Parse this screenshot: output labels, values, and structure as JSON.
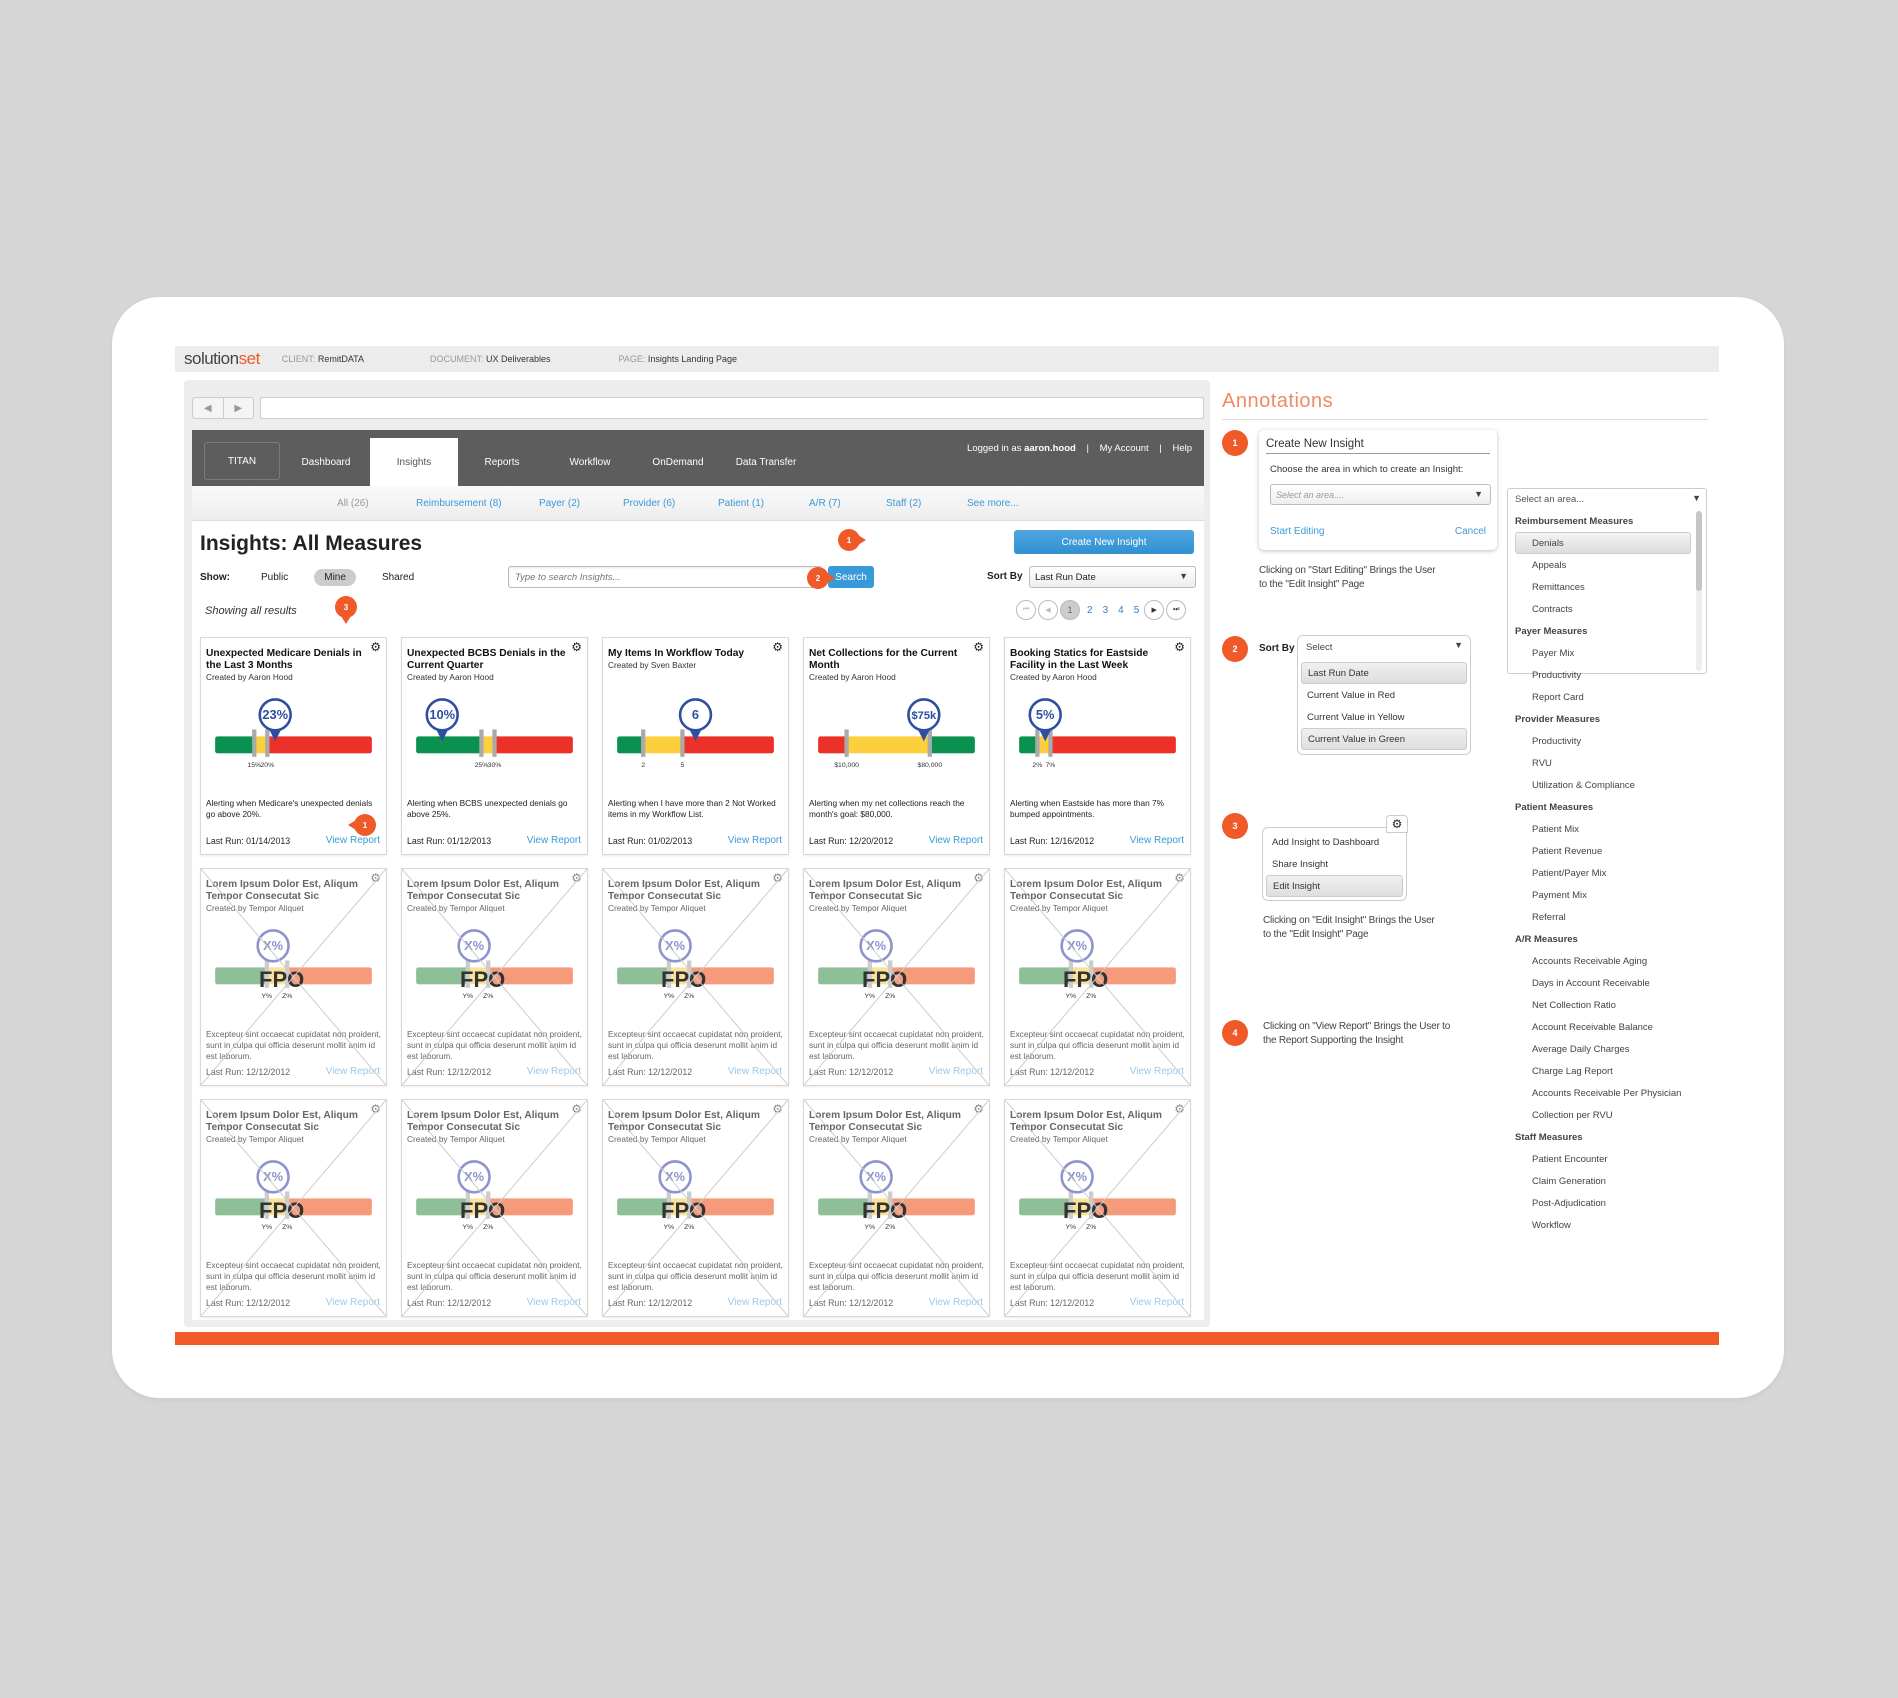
{
  "header": {
    "logo_main": "solution",
    "logo_accent": "set",
    "client_label": "CLIENT:",
    "client_value": "RemitDATA",
    "document_label": "DOCUMENT:",
    "document_value": "UX Deliverables",
    "page_label": "PAGE:",
    "page_value": "Insights Landing Page"
  },
  "browser": {
    "back_icon": "◀",
    "forward_icon": "▶",
    "url": ""
  },
  "appnav": {
    "brand": "TITAN",
    "tabs": [
      {
        "label": "Dashboard",
        "active": false
      },
      {
        "label": "Insights",
        "active": true
      },
      {
        "label": "Reports",
        "active": false
      },
      {
        "label": "Workflow",
        "active": false
      },
      {
        "label": "OnDemand",
        "active": false
      },
      {
        "label": "Data Transfer",
        "active": false
      }
    ],
    "logged_in_prefix": "Logged in as",
    "username": "aaron.hood",
    "my_account": "My Account",
    "help": "Help",
    "separator": "|"
  },
  "filters": [
    {
      "label": "All (26)"
    },
    {
      "label": "Reimbursement (8)"
    },
    {
      "label": "Payer (2)"
    },
    {
      "label": "Provider (6)"
    },
    {
      "label": "Patient (1)"
    },
    {
      "label": "A/R (7)"
    },
    {
      "label": "Staff (2)"
    },
    {
      "label": "See more..."
    }
  ],
  "page": {
    "title": "Insights: All Measures",
    "create_button": "Create New Insight",
    "show_label": "Show:",
    "show_options": [
      "Public",
      "Mine",
      "Shared"
    ],
    "show_selected": "Mine",
    "search_placeholder": "Type to search Insights...",
    "search_button": "Search",
    "sort_label": "Sort By",
    "sort_value": "Last Run Date",
    "showing_text": "Showing all results",
    "pagination": {
      "first_icon": "⏮",
      "prev_icon": "◀",
      "current": "1",
      "pages": [
        "2",
        "3",
        "4",
        "5"
      ],
      "next_icon": "▶",
      "last_icon": "⏭"
    }
  },
  "cards": [
    {
      "title": "Unexpected Medicare Denials in the Last 3 Months",
      "created_by": "Created by Aaron Hood",
      "value_label": "23%",
      "value": 23,
      "zones": [
        "green",
        "yellow",
        "red"
      ],
      "thresholds": [
        15,
        20
      ],
      "threshold_labels": [
        "15%",
        "20%"
      ],
      "range": [
        0,
        60
      ],
      "description": "Alerting when Medicare's unexpected denials go above 20%.",
      "last_run": "Last Run: 01/14/2013",
      "view_report": "View Report"
    },
    {
      "title": "Unexpected BCBS Denials in the Current Quarter",
      "created_by": "Created by Aaron Hood",
      "value_label": "10%",
      "value": 10,
      "zones": [
        "green",
        "yellow",
        "red"
      ],
      "thresholds": [
        25,
        30
      ],
      "threshold_labels": [
        "25%",
        "30%"
      ],
      "range": [
        0,
        60
      ],
      "description": "Alerting when BCBS unexpected denials go above 25%.",
      "last_run": "Last Run: 01/12/2013",
      "view_report": "View Report"
    },
    {
      "title": "My Items In Workflow Today",
      "created_by": "Created by Sven Baxter",
      "value_label": "6",
      "value": 6,
      "zones": [
        "green",
        "yellow",
        "red"
      ],
      "thresholds": [
        2,
        5
      ],
      "threshold_labels": [
        "2",
        "5"
      ],
      "range": [
        0,
        12
      ],
      "description": "Alerting when I have more than 2 Not Worked items in my Workflow List.",
      "last_run": "Last Run: 01/02/2013",
      "view_report": "View Report"
    },
    {
      "title": "Net Collections for the Current Month",
      "created_by": "Created by Aaron Hood",
      "value_label": "$75k",
      "value": 75000,
      "zones": [
        "red",
        "yellow",
        "green"
      ],
      "thresholds": [
        10000,
        80000
      ],
      "threshold_labels": [
        "$10,000",
        "$80,000"
      ],
      "range": [
        -14000,
        118000
      ],
      "description": "Alerting when my net collections reach the month's goal: $80,000.",
      "last_run": "Last Run: 12/20/2012",
      "view_report": "View Report"
    },
    {
      "title": "Booking Statics for Eastside Facility in the Last Week",
      "created_by": "Created by Aaron Hood",
      "value_label": "5%",
      "value": 5,
      "zones": [
        "green",
        "yellow",
        "red"
      ],
      "thresholds": [
        2,
        7
      ],
      "threshold_labels": [
        "2%",
        "7%"
      ],
      "range": [
        -5,
        55
      ],
      "description": "Alerting when Eastside has more than 7% bumped appointments.",
      "last_run": "Last Run: 12/16/2012",
      "view_report": "View Report"
    }
  ],
  "placeholder_card": {
    "title": "Lorem Ipsum Dolor Est, Aliqum Tempor Consecutat Sic",
    "created_by": "Created by Tempor Aliquet",
    "value_label": "X%",
    "fpo": "FPO",
    "threshold_labels": [
      "Y%",
      "Z%"
    ],
    "description": "Excepteur sint occaecat cupidatat non proident, sunt in culpa qui officia deserunt mollit anim id est laborum.",
    "last_run": "Last Run: 12/12/2012",
    "view_report": "View Report",
    "count": 10
  },
  "callouts": {
    "create": "1",
    "sort": "2",
    "gear": "3",
    "view_report": "1"
  },
  "colors": {
    "accent_orange": "#ef5a28",
    "link_blue": "#3a9ad9",
    "gauge_green": "#0a9150",
    "gauge_yellow": "#fbd03c",
    "gauge_red": "#ec3128",
    "marker_blue": "#2f4ea0"
  },
  "annotations": {
    "title": "Annotations",
    "a1": {
      "badge": "1",
      "popup_title": "Create New Insight",
      "prompt": "Choose the area in which to create an Insight:",
      "select_placeholder": "Select an area....",
      "start_editing": "Start Editing",
      "cancel": "Cancel",
      "note": "Clicking on \"Start Editing\" Brings the User to the \"Edit Insight\" Page"
    },
    "area_dropdown": {
      "placeholder": "Select an area...",
      "groups": [
        {
          "heading": "Reimbursement Measures",
          "items": [
            "Denials",
            "Appeals",
            "Remittances",
            "Contracts"
          ]
        },
        {
          "heading": "Payer Measures",
          "items": [
            "Payer Mix",
            "Productivity",
            "Report Card"
          ]
        },
        {
          "heading": "Provider Measures",
          "items": [
            "Productivity",
            "RVU",
            "Utilization & Compliance"
          ]
        },
        {
          "heading": "Patient Measures",
          "items": [
            "Patient Mix",
            "Patient Revenue",
            "Patient/Payer Mix",
            "Payment Mix",
            "Referral"
          ]
        },
        {
          "heading": "A/R Measures",
          "items": [
            "Accounts Receivable Aging",
            "Days in Account Receivable",
            "Net Collection Ratio",
            "Account Receivable Balance",
            "Average Daily Charges",
            "Charge Lag Report",
            "Accounts Receivable Per Physician",
            "Collection per RVU"
          ]
        },
        {
          "heading": "Staff Measures",
          "items": [
            "Patient Encounter",
            "Claim Generation",
            "Post-Adjudication",
            "Workflow"
          ]
        }
      ],
      "highlighted": "Denials"
    },
    "a2": {
      "badge": "2",
      "label": "Sort By",
      "select_value": "Select",
      "options": [
        "Last Run Date",
        "Current Value in Red",
        "Current Value in Yellow",
        "Current Value in Green"
      ],
      "highlighted": [
        "Last Run Date",
        "Current Value in Green"
      ]
    },
    "a3": {
      "badge": "3",
      "menu": [
        "Add Insight to Dashboard",
        "Share Insight",
        "Edit Insight"
      ],
      "highlighted": "Edit Insight",
      "note": "Clicking on \"Edit Insight\" Brings the User to the \"Edit Insight\" Page"
    },
    "a4": {
      "badge": "4",
      "note": "Clicking on \"View Report\" Brings the User to the Report Supporting the Insight"
    }
  }
}
